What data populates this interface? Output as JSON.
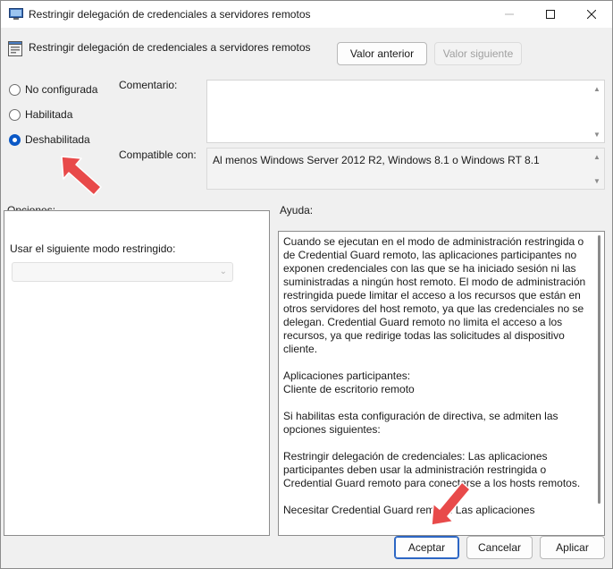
{
  "window": {
    "title": "Restringir delegación de credenciales a servidores remotos"
  },
  "header": {
    "policy_title": "Restringir delegación de credenciales a servidores remotos",
    "prev_button": "Valor anterior",
    "next_button": "Valor siguiente"
  },
  "state_options": [
    {
      "label": "No configurada",
      "checked": false
    },
    {
      "label": "Habilitada",
      "checked": false
    },
    {
      "label": "Deshabilitada",
      "checked": true
    }
  ],
  "comment": {
    "label": "Comentario:",
    "value": ""
  },
  "compatible": {
    "label": "Compatible con:",
    "value": "Al menos Windows Server 2012 R2, Windows 8.1 o Windows RT 8.1"
  },
  "options": {
    "label": "Opciones:",
    "mode_label": "Usar el siguiente modo restringido:",
    "mode_value": ""
  },
  "help": {
    "label": "Ayuda:",
    "paragraphs": [
      "Cuando se ejecutan en el modo de administración restringida o de Credential Guard remoto, las aplicaciones participantes no exponen credenciales con las que se ha iniciado sesión ni las suministradas a ningún host remoto. El modo de administración restringida puede limitar el acceso a los recursos que están en otros servidores del host remoto, ya que las credenciales no se delegan. Credential Guard remoto no limita el acceso a los recursos, ya que redirige todas las solicitudes al dispositivo cliente.",
      "Aplicaciones participantes:\nCliente de escritorio remoto",
      "Si habilitas esta configuración de directiva, se admiten las opciones siguientes:",
      "Restringir delegación de credenciales: Las aplicaciones participantes deben usar la administración restringida o Credential Guard remoto para conectarse a los hosts remotos.",
      "Necesitar Credential Guard remoto: Las aplicaciones"
    ]
  },
  "footer": {
    "ok_button": "Aceptar",
    "cancel_button": "Cancelar",
    "apply_button": "Aplicar"
  },
  "colors": {
    "accent": "#0a58c6",
    "annotation_arrow": "#e84a4a"
  }
}
